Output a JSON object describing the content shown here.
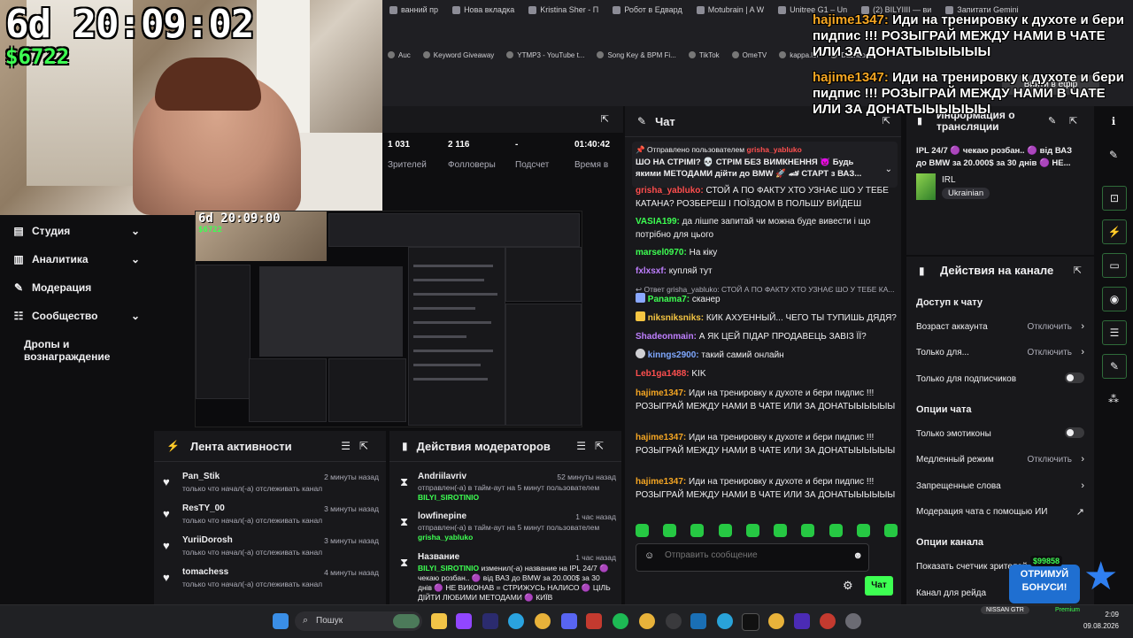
{
  "overlay": {
    "timer": "6d 20:09:02",
    "money": "$6722",
    "alert1": {
      "user": "hajime1347:",
      "text": "Иди на тренировку к духоте и бери пидпис !!! РОЗЫГРАЙ МЕЖДУ НАМИ В ЧАТЕ ИЛИ ЗА ДОНАТЫЫЫЫЫЫ"
    },
    "alert2": {
      "user": "hajime1347:",
      "text": "Иди на тренировку к духоте и бери пидпис !!! РОЗЫГРАЙ МЕЖДУ НАМИ В ЧАТЕ ИЛИ ЗА ДОНАТЫЫЫЫЫЫ"
    }
  },
  "browser": {
    "tabs": [
      "ванний пр",
      "Нова вкладка",
      "Kristina Sher - П",
      "Робот в Едвард",
      "Motubrain | A W",
      "Unitree G1 – Un",
      "(2) BILYIIII — ви",
      "Запитати Gemini"
    ],
    "bookmarks": [
      "Auc",
      "Keyword Giveaway",
      "YTMP3 - YouTube t...",
      "Song Key & BPM Fi...",
      "TikTok",
      "OmeTV",
      "kappa.lol",
      "Dashboard"
    ],
    "go_live": "Вийти в ефір"
  },
  "stats": [
    {
      "value": "1 031",
      "label": "Зрителей"
    },
    {
      "value": "2 116",
      "label": "Фолловеры"
    },
    {
      "value": "-",
      "label": "Подсчет"
    },
    {
      "value": "01:40:42",
      "label": "Время в"
    }
  ],
  "nav": {
    "items": [
      {
        "label": "Студия",
        "icon": "studio-icon"
      },
      {
        "label": "Аналитика",
        "icon": "analytics-icon"
      },
      {
        "label": "Модерация",
        "icon": "wrench-icon"
      },
      {
        "label": "Сообщество",
        "icon": "community-icon"
      },
      {
        "label": "Дропы и вознаграждение",
        "icon": ""
      }
    ]
  },
  "preview": {
    "timer": "6d 20:09:00",
    "money": "$6722"
  },
  "activity": {
    "title": "Лента активности",
    "items": [
      {
        "name": "Pan_Stik",
        "time": "2 минуты назад",
        "desc": "только что начал(-а) отслеживать канал"
      },
      {
        "name": "ResTY_00",
        "time": "3 минуты назад",
        "desc": "только что начал(-а) отслеживать канал"
      },
      {
        "name": "YuriiDorosh",
        "time": "3 минуты назад",
        "desc": "только что начал(-а) отслеживать канал"
      },
      {
        "name": "tomachess",
        "time": "4 минуты назад",
        "desc": "только что начал(-а) отслеживать канал"
      }
    ]
  },
  "modactions": {
    "title": "Действия модераторов",
    "items": [
      {
        "name": "Andriilavriv",
        "time": "52 минуты назад",
        "desc": "отправлен(-а) в тайм-аут на 5 минут пользователем",
        "who": "BILYI_SIROTINIO"
      },
      {
        "name": "lowfinepine",
        "time": "1 час назад",
        "desc": "отправлен(-а) в тайм-аут на 5 минут пользователем",
        "who": "grisha_yabluko"
      },
      {
        "name": "Название",
        "time": "1 час назад",
        "who": "BILYI_SIROTINIO",
        "desc": "изменил(-а) название на IPL 24/7 🟣 чекаю розбан.. 🟣 від ВАЗ до BMW за 20.000$ за 30 днів 🟣 НЕ ВИКОНАВ = СТРИЖУСЬ НАЛИСО 🟣 ЦІЛЬ ДІЙТИ ЛЮБИМИ МЕТОДАМИ 🟣 КИЇВ"
      }
    ]
  },
  "chat": {
    "title": "Чат",
    "pinned_by_label": "Отправлено пользователем",
    "pinned_by": "grisha_yabluko",
    "pinned_text": "ШО НА СТРІМІ? 💀 СТРІМ БЕЗ ВИМКНЕННЯ 👿 Будь якими МЕТОДАМИ дійти до BMW 🚀 🏎 СТАРТ з ВАЗ...",
    "messages": [
      {
        "user": "grisha_yabluko:",
        "color": "#ff4f4f",
        "text": "СТОЙ А ПО ФАКТУ ХТО УЗНАЄ ШО У ТЕБЕ КАТАНА? РОЗБЕРЕШ І ПОЇЗДОМ В ПОЛЬШУ ВИЇДЕШ"
      },
      {
        "user": "VASIA199:",
        "color": "#3dff52",
        "text": "да лішпе запитай чи можна буде вивести і що потрібно для цього"
      },
      {
        "user": "marsel0970:",
        "color": "#3dff52",
        "text": "На кіку"
      },
      {
        "user": "fxlxsxf:",
        "color": "#bf7fff",
        "text": "купляй тут"
      },
      {
        "user": "Panama7:",
        "color": "#3dff52",
        "text": "сканер",
        "reply": "Ответ grisha_yabluko: СТОЙ А ПО ФАКТУ ХТО УЗНАЄ ШО У ТЕБЕ КА..."
      },
      {
        "user": "niksniksniks:",
        "color": "#f5c542",
        "text": "КИК АХУЕННЫЙ... ЧЕГО ТЫ ТУПИШЬ ДЯДЯ?"
      },
      {
        "user": "Shadeonmain:",
        "color": "#bf7fff",
        "text": "А ЯК ЦЕЙ ПІДАР ПРОДАВЕЦЬ ЗАВІЗ ЇЇ?"
      },
      {
        "user": "kinngs2900:",
        "color": "#7fa8ff",
        "text": "такий самий онлайн"
      },
      {
        "user": "Leb1ga1488:",
        "color": "#ff4f4f",
        "text": "KIK"
      },
      {
        "user": "hajime1347:",
        "color": "#f5a623",
        "text": "Иди на тренировку к духоте и бери пидпис !!! РОЗЫГРАЙ МЕЖДУ НАМИ В ЧАТЕ ИЛИ ЗА ДОНАТЫЫЫЫЫЫ"
      },
      {
        "user": "hajime1347:",
        "color": "#f5a623",
        "text": "Иди на тренировку к духоте и бери пидпис !!! РОЗЫГРАЙ МЕЖДУ НАМИ В ЧАТЕ ИЛИ ЗА ДОНАТЫЫЫЫЫЫ"
      },
      {
        "user": "hajime1347:",
        "color": "#f5a623",
        "text": "Иди на тренировку к духоте и бери пидпис !!! РОЗЫГРАЙ МЕЖДУ НАМИ В ЧАТЕ ИЛИ ЗА ДОНАТЫЫЫЫЫЫ"
      }
    ],
    "placeholder": "Отправить сообщение",
    "send": "Чат"
  },
  "info": {
    "title": "Информация о трансляции",
    "stream_title": "IPL 24/7 🟣 чекаю розбан.. 🟣 від ВАЗ до BMW за 20.000$ за 30 днів 🟣 НЕ...",
    "category": "IRL",
    "tag": "Ukrainian"
  },
  "actions": {
    "title": "Действия на канале",
    "chat_access": "Доступ к чату",
    "age": {
      "label": "Возраст аккаунта",
      "value": "Отключить"
    },
    "only_for": {
      "label": "Только для...",
      "value": "Отключить"
    },
    "subs_only": "Только для подписчиков",
    "chat_options": "Опции чата",
    "emotes_only": "Только эмотиконы",
    "slow_mode": {
      "label": "Медленный режим",
      "value": "Отключить"
    },
    "banned_words": "Запрещенные слова",
    "ai_mod": "Модерация чата с помощью ИИ",
    "channel_options": "Опции канала",
    "viewer_counter": "Показать счетчик зрителей",
    "raid": "Канал для рейда"
  },
  "promo": {
    "money": "$99858",
    "text": "ОТРИМУЙ БОНУСИ!"
  },
  "taskbar": {
    "search": "Пошук",
    "time": "2:09",
    "date": "09.08.2026",
    "badge": "NISSAN GTR",
    "premium": "Premium"
  }
}
